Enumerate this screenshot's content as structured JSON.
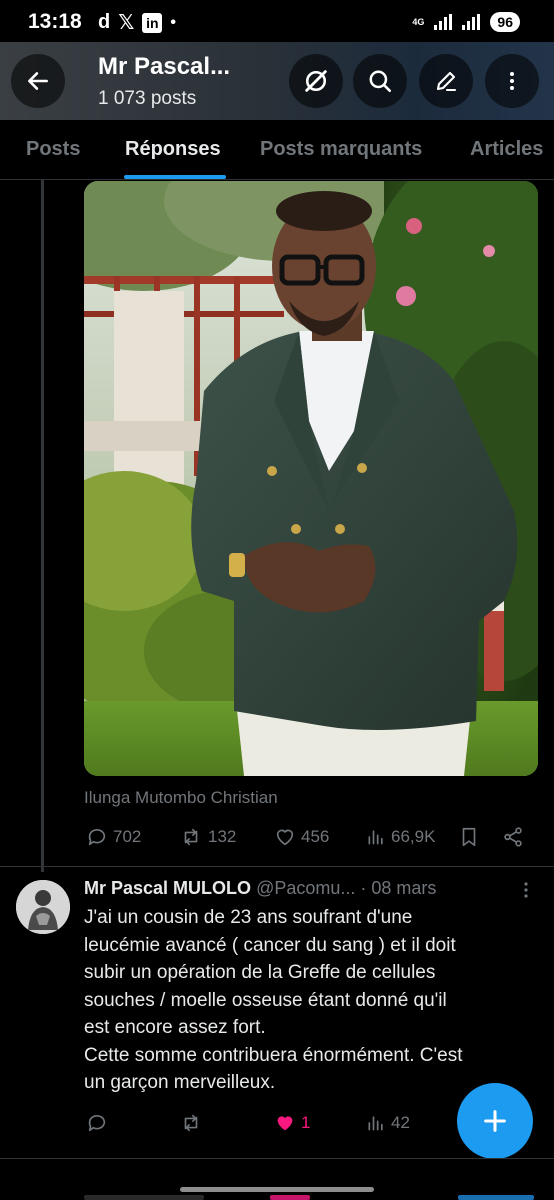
{
  "status_bar": {
    "time": "13:18",
    "notif_d": "d",
    "notif_x": "𝕏",
    "notif_in": "in",
    "notif_dot": "•",
    "network": "4G",
    "battery": "96"
  },
  "header": {
    "title": "Mr Pascal...",
    "posts_count": "1 073 posts"
  },
  "tabs": [
    {
      "label": "Posts"
    },
    {
      "label": "Réponses"
    },
    {
      "label": "Posts marquants"
    },
    {
      "label": "Articles"
    }
  ],
  "post": {
    "image_alt": "Photo of a man in a green double-breasted blazer",
    "caption": "Ilunga Mutombo Christian",
    "actions": {
      "replies": "702",
      "reposts": "132",
      "likes": "456",
      "views": "66,9K"
    }
  },
  "reply": {
    "name": "Mr Pascal MULOLO",
    "handle": "@Pacomu...",
    "date": "· 08 mars",
    "text": "J'ai un cousin de 23 ans soufrant d'une\nleucémie avancé ( cancer du sang ) et il doit\nsubir un opération de la Greffe de cellules\nsouches / moelle osseuse étant donné qu'il\nest encore assez fort.\nCette somme contribuera énormément. C'est\nun garçon merveilleux.",
    "actions": {
      "likes": "1",
      "views": "42"
    }
  },
  "colors": {
    "accent": "#1d9bf0",
    "like": "#f91880",
    "muted": "#71767b"
  },
  "icons": [
    "back-arrow-icon",
    "grok-icon",
    "search-icon",
    "compose-icon",
    "more-icon",
    "reply-icon",
    "repost-icon",
    "heart-icon",
    "views-icon",
    "bookmark-icon",
    "share-icon",
    "plus-icon"
  ]
}
